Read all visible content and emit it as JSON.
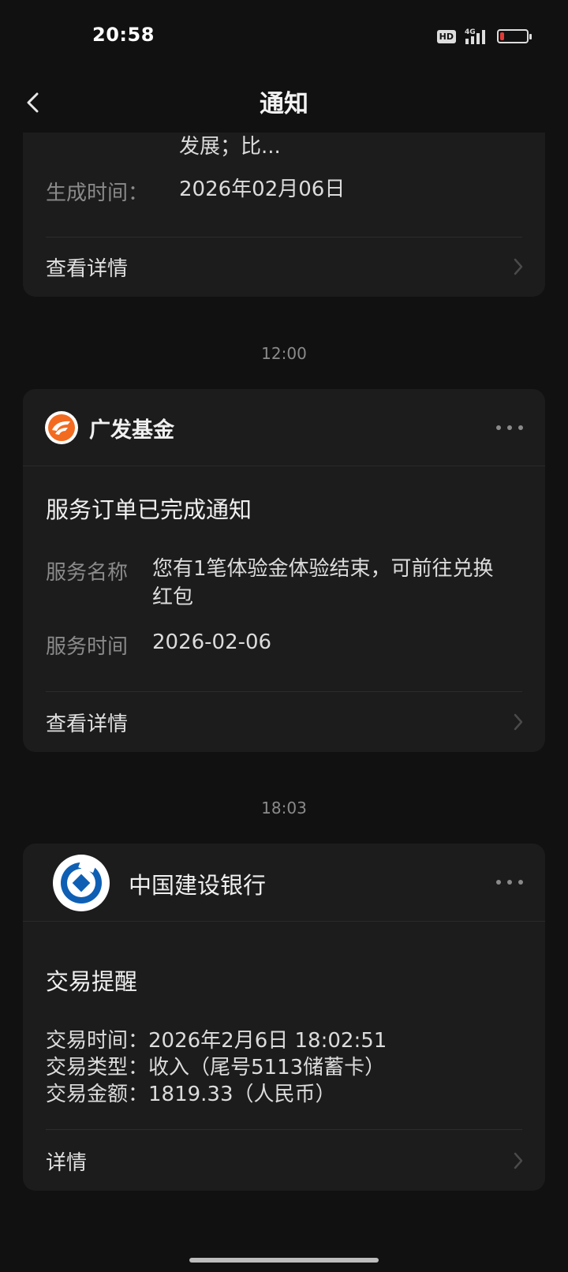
{
  "status": {
    "time": "20:58",
    "network": "4G",
    "hd": "HD",
    "battery_level": 0.15,
    "battery_color": "#e53935"
  },
  "header": {
    "title": "通知",
    "back_icon": "chevron-left-icon"
  },
  "card_prev": {
    "content_tail": "发展；比...",
    "generated_label": "生成时间：",
    "generated_value": "2026年02月06日",
    "detail_link": "查看详情"
  },
  "separator_1": "12:00",
  "card_gf": {
    "brand_name": "广发基金",
    "brand_color": "#f26b21",
    "title": "服务订单已完成通知",
    "rows": [
      {
        "label": "服务名称",
        "value": "您有1笔体验金体验结束，可前往兑换红包"
      },
      {
        "label": "服务时间",
        "value": "2026-02-06"
      }
    ],
    "detail_link": "查看详情"
  },
  "separator_2": "18:03",
  "card_ccb": {
    "brand_name": "中国建设银行",
    "brand_color": "#0e5fb4",
    "title": "交易提醒",
    "lines": [
      "交易时间：2026年2月6日 18:02:51",
      "交易类型：收入（尾号5113储蓄卡）",
      "交易金额：1819.33（人民币）"
    ],
    "detail_link": "详情"
  }
}
